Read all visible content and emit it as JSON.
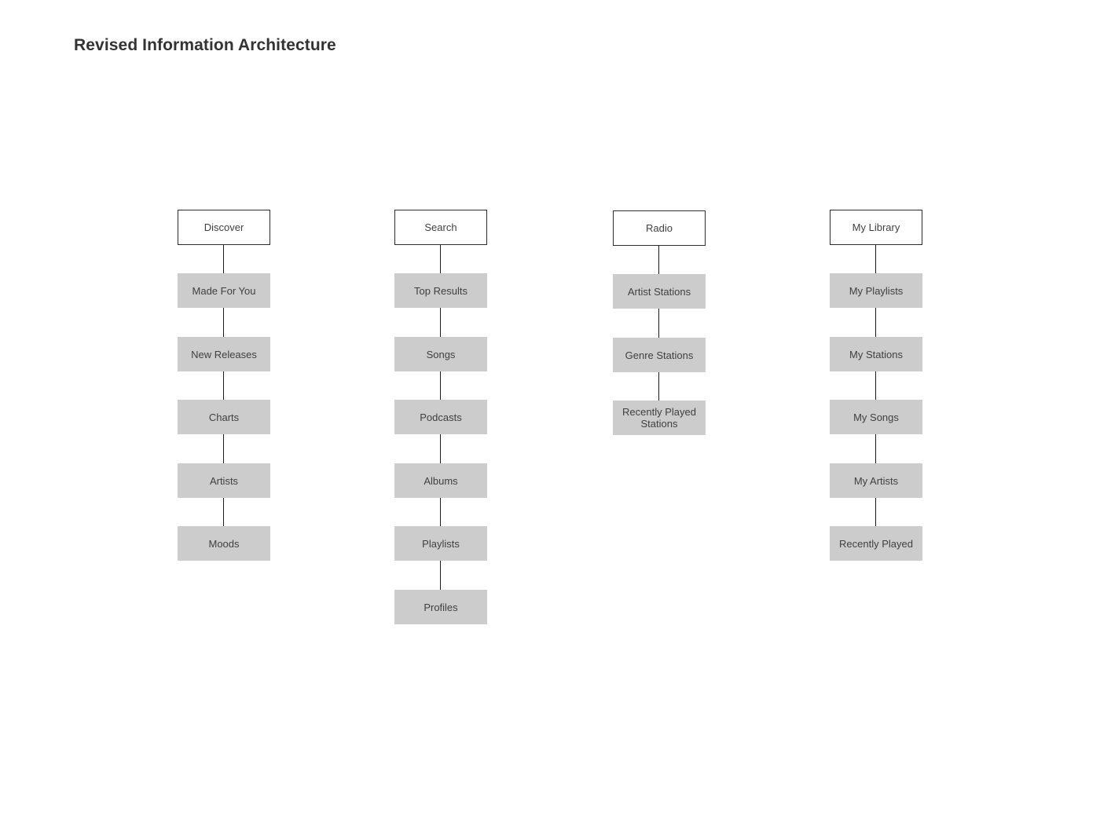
{
  "page": {
    "title": "Revised Information Architecture",
    "background_color": "#ffffff",
    "root_fill": "#ffffff",
    "root_border_color": "#2b2b2b",
    "child_fill": "#cccccc",
    "text_color": "#404040",
    "connector_color": "#1a1a1a"
  },
  "diagram": {
    "type": "tree",
    "orientation": "vertical-chain",
    "columns": [
      {
        "id": "discover",
        "root": {
          "label": "Discover"
        },
        "children": [
          {
            "label": "Made For You"
          },
          {
            "label": "New Releases"
          },
          {
            "label": "Charts"
          },
          {
            "label": "Artists"
          },
          {
            "label": "Moods"
          }
        ]
      },
      {
        "id": "search",
        "root": {
          "label": "Search"
        },
        "children": [
          {
            "label": "Top Results"
          },
          {
            "label": "Songs"
          },
          {
            "label": "Podcasts"
          },
          {
            "label": "Albums"
          },
          {
            "label": "Playlists"
          },
          {
            "label": "Profiles"
          }
        ]
      },
      {
        "id": "radio",
        "root": {
          "label": "Radio"
        },
        "children": [
          {
            "label": "Artist Stations"
          },
          {
            "label": "Genre Stations"
          },
          {
            "label": "Recently Played Stations"
          }
        ]
      },
      {
        "id": "my-library",
        "root": {
          "label": "My Library"
        },
        "children": [
          {
            "label": "My Playlists"
          },
          {
            "label": "My Stations"
          },
          {
            "label": "My Songs"
          },
          {
            "label": "My Artists"
          },
          {
            "label": "Recently Played"
          }
        ]
      }
    ]
  }
}
